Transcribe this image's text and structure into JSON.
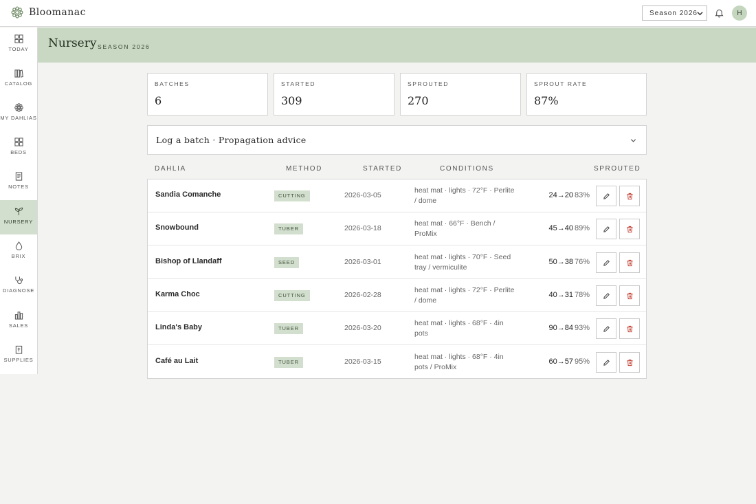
{
  "app": {
    "name": "Bloomanac"
  },
  "topbar": {
    "season_select": "Season 2026",
    "avatar_initial": "H"
  },
  "sidebar": {
    "items": [
      {
        "label": "TODAY",
        "icon": "today-icon"
      },
      {
        "label": "CATALOG",
        "icon": "catalog-icon"
      },
      {
        "label": "MY DAHLIAS",
        "icon": "flower-icon"
      },
      {
        "label": "BEDS",
        "icon": "beds-icon"
      },
      {
        "label": "NOTES",
        "icon": "notes-icon"
      },
      {
        "label": "NURSERY",
        "icon": "sprout-icon",
        "active": true
      },
      {
        "label": "BRIX",
        "icon": "droplet-icon"
      },
      {
        "label": "DIAGNOSE",
        "icon": "stethoscope-icon"
      },
      {
        "label": "SALES",
        "icon": "bar-chart-icon"
      },
      {
        "label": "SUPPLIES",
        "icon": "clipboard-icon"
      }
    ]
  },
  "header": {
    "title": "Nursery",
    "subtitle": "SEASON 2026"
  },
  "stats": [
    {
      "label": "BATCHES",
      "value": "6"
    },
    {
      "label": "STARTED",
      "value": "309"
    },
    {
      "label": "SPROUTED",
      "value": "270"
    },
    {
      "label": "SPROUT RATE",
      "value": "87%"
    }
  ],
  "advice": {
    "title": "Log a batch · Propagation advice"
  },
  "table": {
    "headers": {
      "dahlia": "DAHLIA",
      "method": "METHOD",
      "started": "STARTED",
      "conditions": "CONDITIONS",
      "sprouted": "SPROUTED"
    },
    "rows": [
      {
        "name": "Sandia Comanche",
        "method": "CUTTING",
        "started": "2026-03-05",
        "conditions": "heat mat · lights · 72°F · Perlite / dome",
        "counts": "24→20",
        "pct": "83%"
      },
      {
        "name": "Snowbound",
        "method": "TUBER",
        "started": "2026-03-18",
        "conditions": "heat mat · 66°F · Bench / ProMix",
        "counts": "45→40",
        "pct": "89%"
      },
      {
        "name": "Bishop of Llandaff",
        "method": "SEED",
        "started": "2026-03-01",
        "conditions": "heat mat · lights · 70°F · Seed tray / vermiculite",
        "counts": "50→38",
        "pct": "76%"
      },
      {
        "name": "Karma Choc",
        "method": "CUTTING",
        "started": "2026-02-28",
        "conditions": "heat mat · lights · 72°F · Perlite / dome",
        "counts": "40→31",
        "pct": "78%"
      },
      {
        "name": "Linda's Baby",
        "method": "TUBER",
        "started": "2026-03-20",
        "conditions": "heat mat · lights · 68°F · 4in pots",
        "counts": "90→84",
        "pct": "93%"
      },
      {
        "name": "Café au Lait",
        "method": "TUBER",
        "started": "2026-03-15",
        "conditions": "heat mat · lights · 68°F · 4in pots / ProMix",
        "counts": "60→57",
        "pct": "95%"
      }
    ]
  },
  "colors": {
    "accent": "#c8d8c3",
    "active_nav": "#d3dfce",
    "danger": "#c0392b"
  }
}
